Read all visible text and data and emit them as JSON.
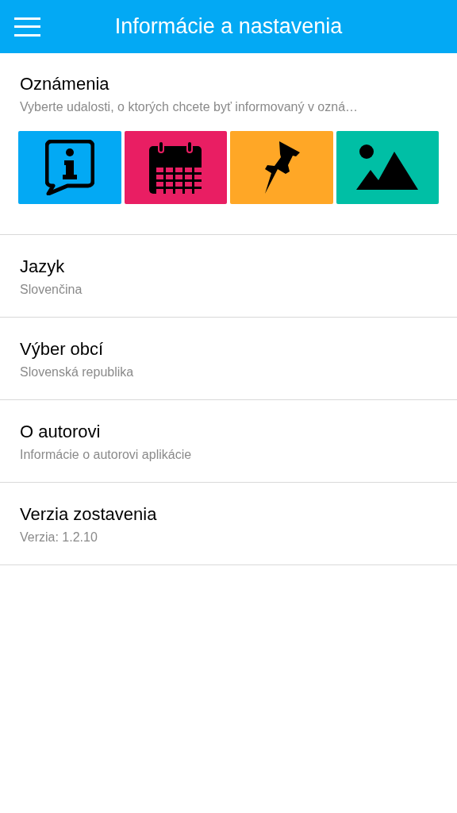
{
  "header": {
    "title": "Informácie a nastavenia"
  },
  "notifications": {
    "title": "Oznámenia",
    "subtitle": "Vyberte udalosti, o ktorých chcete byť informovaný v ozná…",
    "tiles": [
      {
        "kind": "info",
        "color": "#03a9f4"
      },
      {
        "kind": "calendar",
        "color": "#e91e63"
      },
      {
        "kind": "pin",
        "color": "#ffa726"
      },
      {
        "kind": "image",
        "color": "#00bfa5"
      }
    ]
  },
  "items": [
    {
      "title": "Jazyk",
      "subtitle": "Slovenčina"
    },
    {
      "title": "Výber obcí",
      "subtitle": "Slovenská republika"
    },
    {
      "title": "O autorovi",
      "subtitle": "Informácie o autorovi aplikácie"
    },
    {
      "title": "Verzia zostavenia",
      "subtitle": "Verzia: 1.2.10"
    }
  ]
}
